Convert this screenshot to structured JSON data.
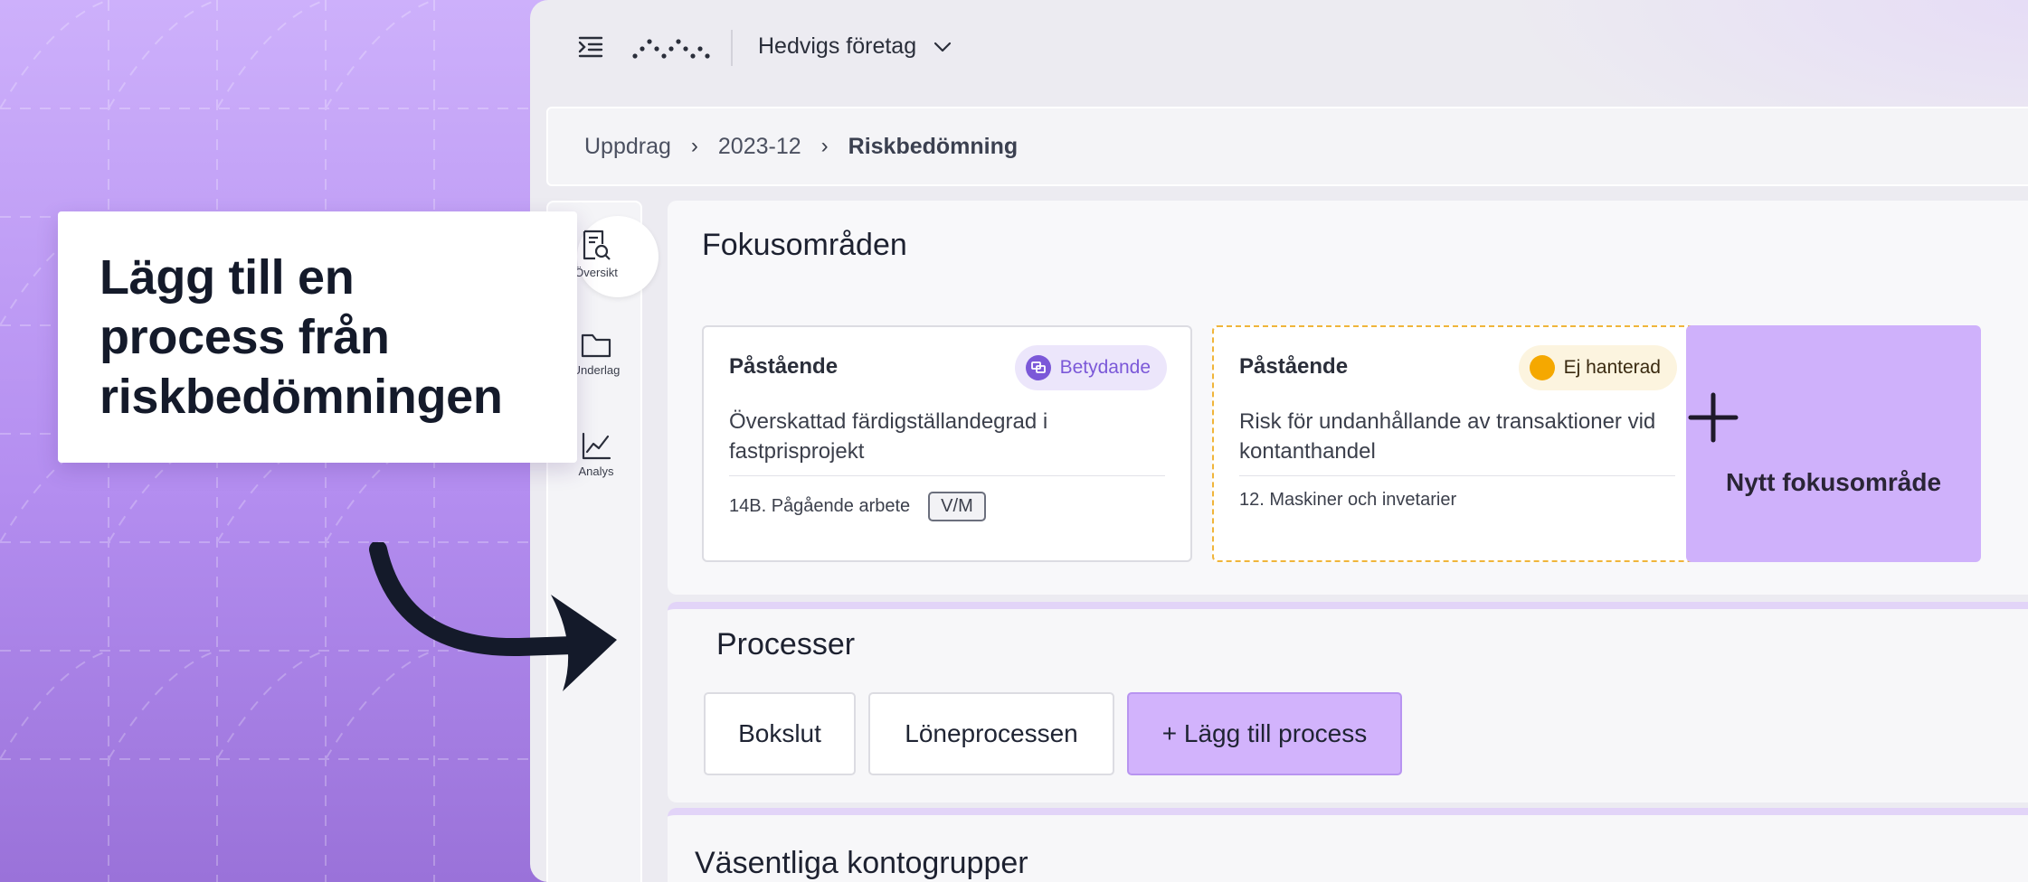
{
  "callout": {
    "text": "Lägg till en process från riskbedömningen"
  },
  "topbar": {
    "company": "Hedvigs företag"
  },
  "breadcrumb": {
    "items": [
      "Uppdrag",
      "2023-12",
      "Riskbedömning"
    ]
  },
  "rail": {
    "items": [
      {
        "label": "Översikt",
        "icon": "overview-icon"
      },
      {
        "label": "Underlag",
        "icon": "folder-icon"
      },
      {
        "label": "Analys",
        "icon": "chart-icon"
      }
    ]
  },
  "focus": {
    "title": "Fokusområden",
    "cards": [
      {
        "title": "Påstående",
        "badge": "Betydande",
        "description": "Överskattad färdigställandegrad i fastprisprojekt",
        "account": "14B. Pågående arbete",
        "tag": "V/M"
      },
      {
        "title": "Påstående",
        "badge": "Ej hanterad",
        "description": "Risk för undanhållande av transaktioner vid kontanthandel",
        "account": "12. Maskiner och invetarier"
      }
    ],
    "new_label": "Nytt fokusområde"
  },
  "processes": {
    "title": "Processer",
    "items": [
      "Bokslut",
      "Löneprocessen"
    ],
    "add_label": "+ Lägg till process"
  },
  "kontogrupper": {
    "title": "Väsentliga kontogrupper"
  },
  "colors": {
    "accent": "#cfb1fb",
    "significant": "#7b58d8",
    "unhandled": "#f5a800",
    "dashed_border": "#f0b53a"
  }
}
